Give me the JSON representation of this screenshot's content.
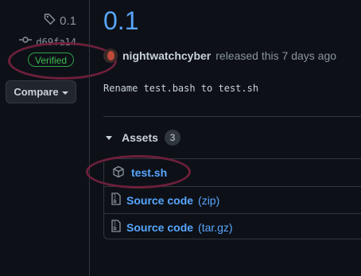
{
  "sidebar": {
    "tag": "0.1",
    "commit": "d69fa14",
    "verified": "Verified",
    "compare_label": "Compare"
  },
  "release": {
    "title": "0.1",
    "author": "nightwatchcyber",
    "released_text": "released this 7 days ago",
    "description": "Rename test.bash to test.sh"
  },
  "assets": {
    "label": "Assets",
    "count": "3",
    "items": [
      {
        "name": "test.sh",
        "suffix": "",
        "icon": "package-icon"
      },
      {
        "name": "Source code",
        "suffix": "(zip)",
        "icon": "file-zip-icon"
      },
      {
        "name": "Source code",
        "suffix": "(tar.gz)",
        "icon": "file-zip-icon"
      }
    ]
  },
  "colors": {
    "accent": "#58a6ff",
    "verified": "#3fb950",
    "annotation": "#6d1f3a",
    "background": "#0d1117"
  }
}
